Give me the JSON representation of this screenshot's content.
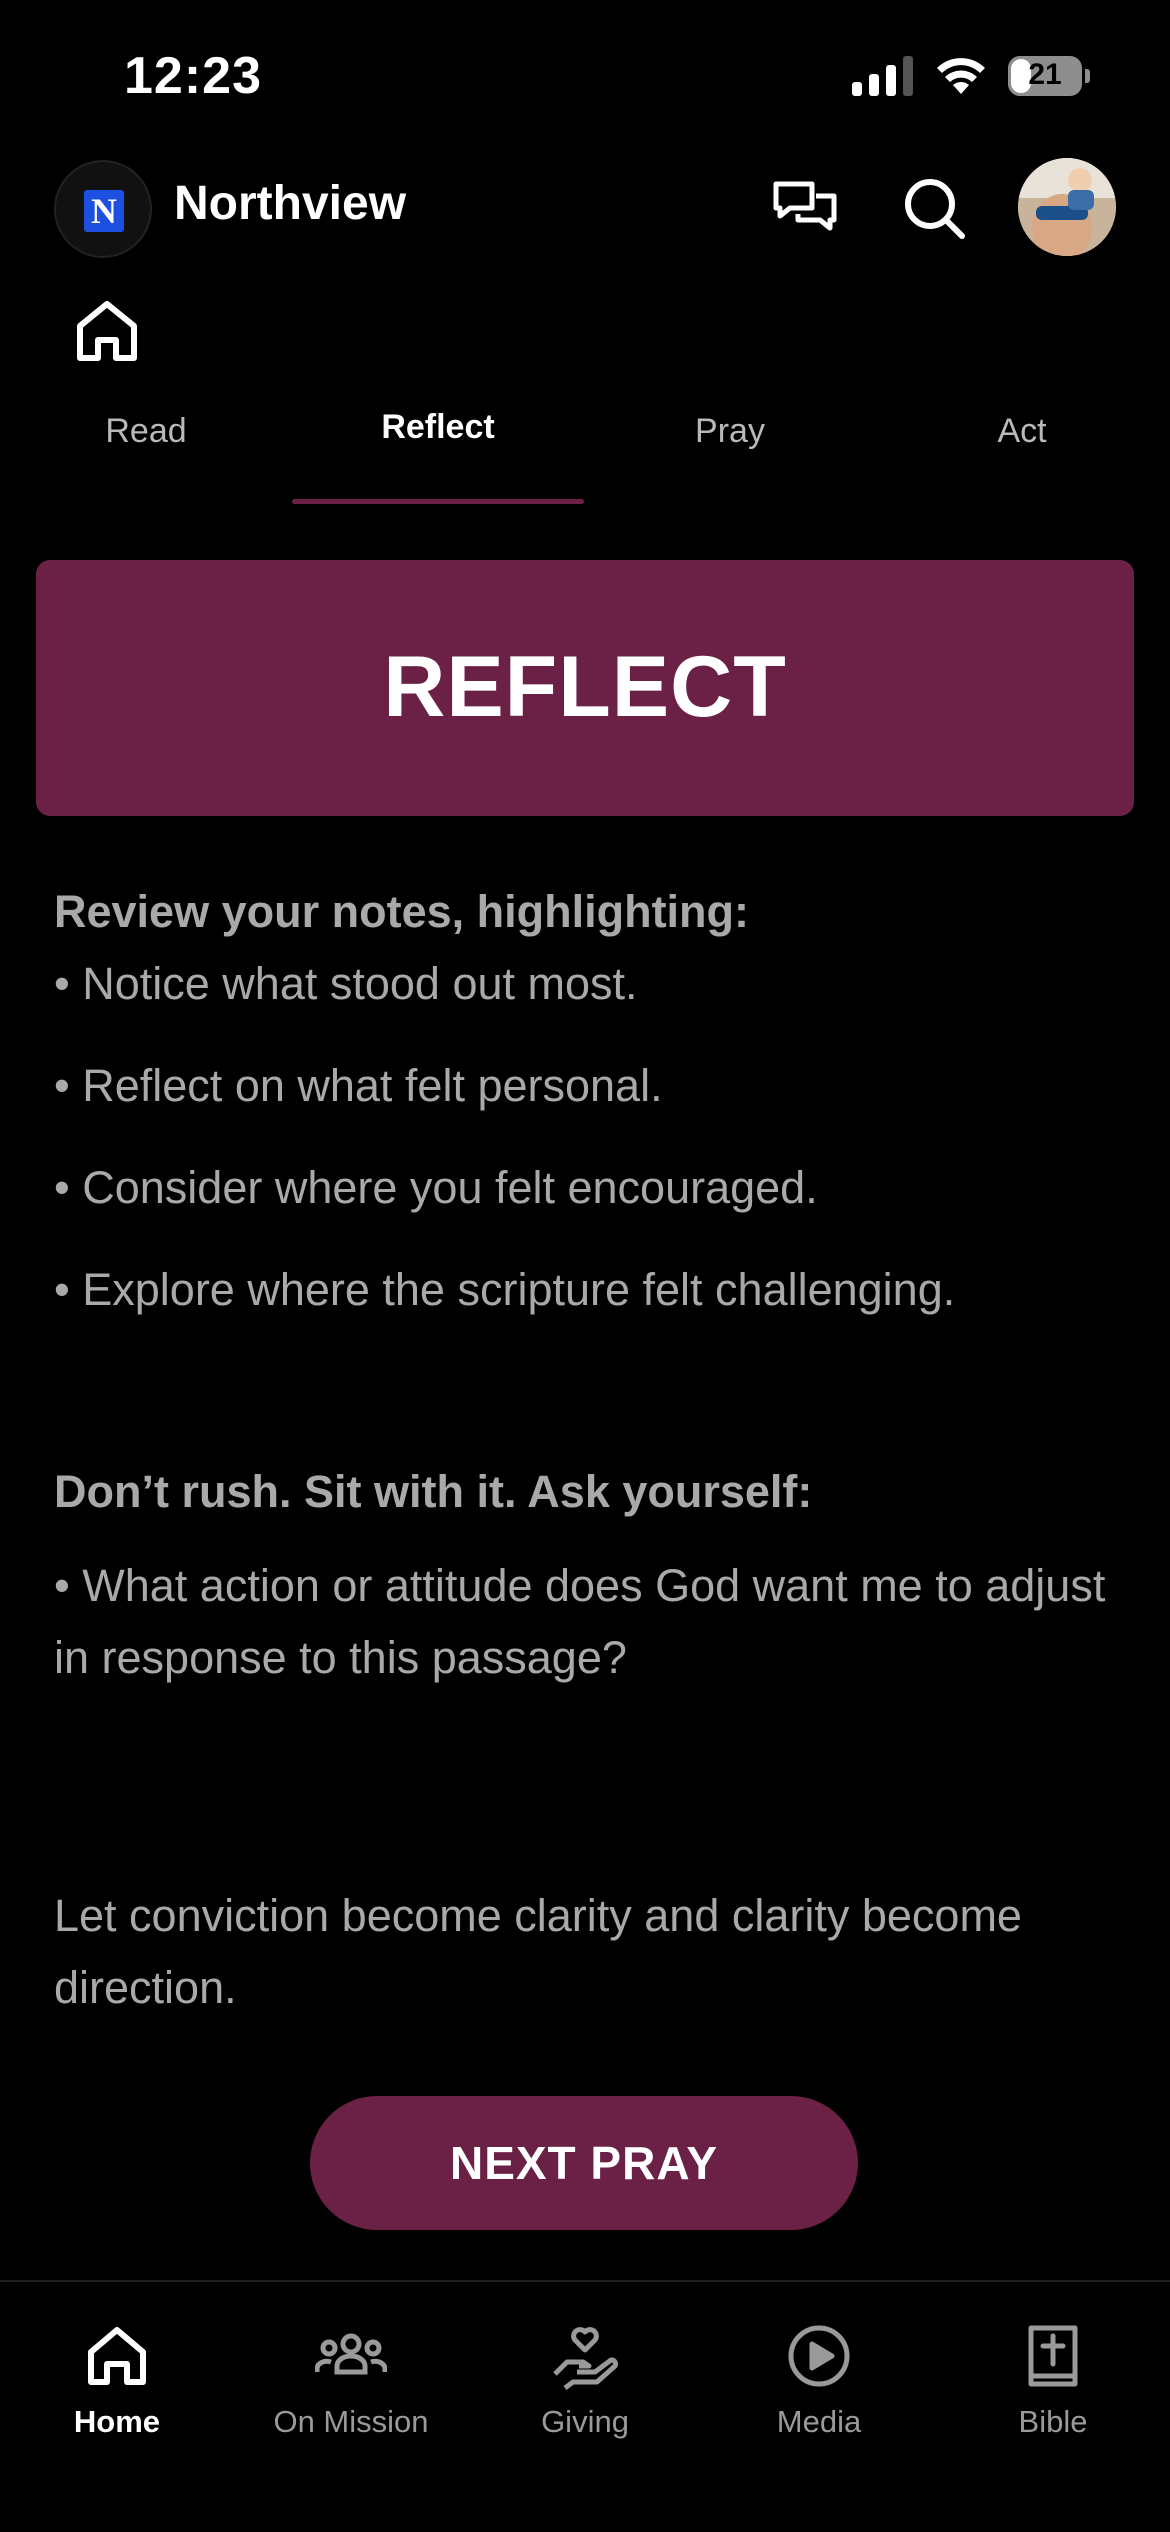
{
  "status_bar": {
    "time": "12:23",
    "battery": "21"
  },
  "header": {
    "app_name": "Northview",
    "logo_letter": "N"
  },
  "tabs": [
    {
      "label": "Read",
      "active": false
    },
    {
      "label": "Reflect",
      "active": true
    },
    {
      "label": "Pray",
      "active": false
    },
    {
      "label": "Act",
      "active": false
    }
  ],
  "banner": {
    "title": "REFLECT"
  },
  "content": {
    "heading1": "Review your notes, highlighting:",
    "bullets": [
      "• Notice what stood out most.",
      "• Reflect on what felt personal.",
      "• Consider where you felt encouraged.",
      "• Explore where the scripture felt challenging."
    ],
    "heading2": "Don’t rush. Sit with it. Ask yourself:",
    "question": "• What action or attitude does God want me to adjust in response to this passage?",
    "closing": "Let conviction become clarity and clarity become direction."
  },
  "next_button": {
    "label": "NEXT PRAY"
  },
  "bottom_nav": [
    {
      "label": "Home",
      "icon": "home-icon",
      "active": true
    },
    {
      "label": "On Mission",
      "icon": "people-icon",
      "active": false
    },
    {
      "label": "Giving",
      "icon": "giving-hand-heart-icon",
      "active": false
    },
    {
      "label": "Media",
      "icon": "play-circle-icon",
      "active": false
    },
    {
      "label": "Bible",
      "icon": "bible-cross-icon",
      "active": false
    }
  ],
  "colors": {
    "accent": "#6b2046",
    "background": "#000000",
    "body_text": "#a9a9a9"
  }
}
